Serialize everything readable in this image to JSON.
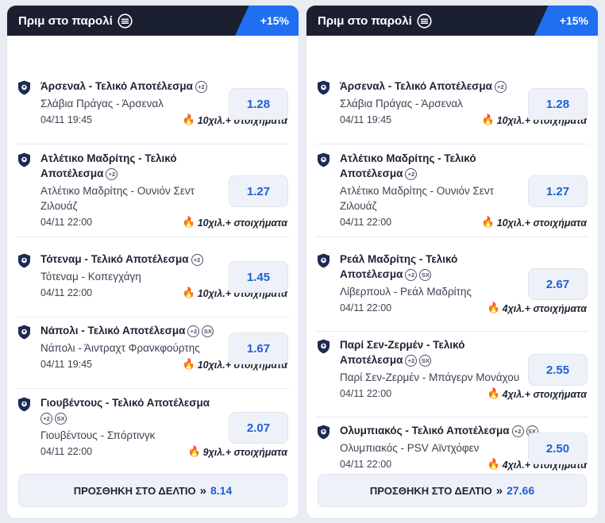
{
  "colors": {
    "header_bg": "#1b2030",
    "accent": "#1f6ff0",
    "odds_text": "#1f5fd6",
    "fire": "#f0581c"
  },
  "cards": [
    {
      "title": "Πριμ στο παρολί",
      "boost": "+15%",
      "add_label": "ΠΡΟΣΘΗΚΗ ΣΤΟ ΔΕΛΤΙΟ",
      "add_chevron": "»",
      "total_odds": "8.14",
      "bets": [
        {
          "title_l1": "Άρσεναλ - Τελικό Αποτέλεσμα",
          "title_l2": "",
          "pills": [
            "+2"
          ],
          "match_l1": "Σλάβια Πράγας - Άρσεναλ",
          "match_l2": "",
          "time": "04/11 19:45",
          "volume": "10χιλ.+ στοιχήματα",
          "odds": "1.28"
        },
        {
          "title_l1": "Ατλέτικο Μαδρίτης - Τελικό",
          "title_l2": "Αποτέλεσμα",
          "pills": [
            "+2"
          ],
          "match_l1": "Ατλέτικο Μαδρίτης - Ουνιόν Σεντ",
          "match_l2": "Ζιλουάζ",
          "time": "04/11 22:00",
          "volume": "10χιλ.+ στοιχήματα",
          "odds": "1.27"
        },
        {
          "title_l1": "Τότεναμ - Τελικό Αποτέλεσμα",
          "title_l2": "",
          "pills": [
            "+2"
          ],
          "match_l1": "Τότεναμ - Κοπεγχάγη",
          "match_l2": "",
          "time": "04/11 22:00",
          "volume": "10χιλ.+ στοιχήματα",
          "odds": "1.45"
        },
        {
          "title_l1": "Νάπολι - Τελικό Αποτέλεσμα",
          "title_l2": "",
          "pills": [
            "+2",
            "SX"
          ],
          "match_l1": "Νάπολι - Άιντραχτ Φρανκφούρτης",
          "match_l2": "",
          "time": "04/11 19:45",
          "volume": "10χιλ.+ στοιχήματα",
          "odds": "1.67"
        },
        {
          "title_l1": "Γιουβέντους - Τελικό Αποτέλεσμα",
          "title_l2": "",
          "pills": [
            "+2",
            "SX"
          ],
          "match_l1": "Γιουβέντους - Σπόρτινγκ",
          "match_l2": "",
          "time": "04/11 22:00",
          "volume": "9χιλ.+ στοιχήματα",
          "odds": "2.07"
        }
      ]
    },
    {
      "title": "Πριμ στο παρολί",
      "boost": "+15%",
      "add_label": "ΠΡΟΣΘΗΚΗ ΣΤΟ ΔΕΛΤΙΟ",
      "add_chevron": "»",
      "total_odds": "27.66",
      "bets": [
        {
          "title_l1": "Άρσεναλ - Τελικό Αποτέλεσμα",
          "title_l2": "",
          "pills": [
            "+2"
          ],
          "match_l1": "Σλάβια Πράγας - Άρσεναλ",
          "match_l2": "",
          "time": "04/11 19:45",
          "volume": "10χιλ.+ στοιχήματα",
          "odds": "1.28"
        },
        {
          "title_l1": "Ατλέτικο Μαδρίτης - Τελικό",
          "title_l2": "Αποτέλεσμα",
          "pills": [
            "+2"
          ],
          "match_l1": "Ατλέτικο Μαδρίτης - Ουνιόν Σεντ",
          "match_l2": "Ζιλουάζ",
          "time": "04/11 22:00",
          "volume": "10χιλ.+ στοιχήματα",
          "odds": "1.27"
        },
        {
          "title_l1": "Ρεάλ Μαδρίτης - Τελικό",
          "title_l2": "Αποτέλεσμα",
          "pills": [
            "+2",
            "SX"
          ],
          "match_l1": "Λίβερπουλ - Ρεάλ Μαδρίτης",
          "match_l2": "",
          "time": "04/11 22:00",
          "volume": "4χιλ.+ στοιχήματα",
          "odds": "2.67"
        },
        {
          "title_l1": "Παρί Σεν-Ζερμέν - Τελικό",
          "title_l2": "Αποτέλεσμα",
          "pills": [
            "+2",
            "SX"
          ],
          "match_l1": "Παρί Σεν-Ζερμέν - Μπάγερν Μονάχου",
          "match_l2": "",
          "time": "04/11 22:00",
          "volume": "4χιλ.+ στοιχήματα",
          "odds": "2.55"
        },
        {
          "title_l1": "Ολυμπιακός - Τελικό Αποτέλεσμα",
          "title_l2": "",
          "pills": [
            "+2",
            "SX"
          ],
          "match_l1": "Ολυμπιακός - PSV Αϊντχόφεν",
          "match_l2": "",
          "time": "04/11 22:00",
          "volume": "4χιλ.+ στοιχήματα",
          "odds": "2.50"
        }
      ]
    }
  ]
}
